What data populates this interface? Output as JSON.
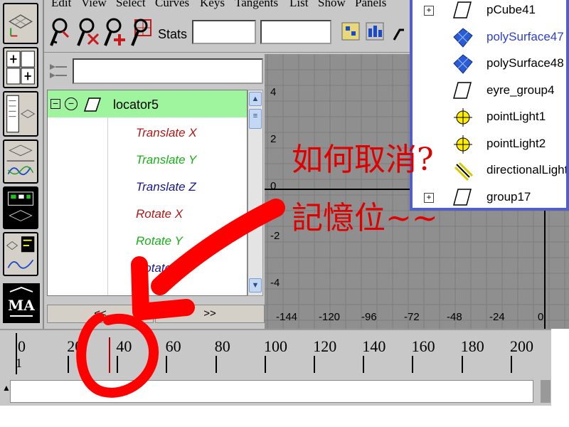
{
  "menubar": {
    "items": [
      "Edit",
      "View",
      "Select",
      "Curves",
      "Keys",
      "Tangents",
      "List",
      "Show",
      "Panels"
    ]
  },
  "toolbar": {
    "stats_label": "Stats",
    "stats_value_1": "",
    "stats_value_2": ""
  },
  "outliner": {
    "filter_value": "",
    "selected_node": "locator5",
    "attributes": [
      {
        "label": "Translate X",
        "color": "#b01818"
      },
      {
        "label": "Translate Y",
        "color": "#18b018"
      },
      {
        "label": "Translate Z",
        "color": "#18188a"
      },
      {
        "label": "Rotate X",
        "color": "#b01818"
      },
      {
        "label": "Rotate Y",
        "color": "#18b018"
      },
      {
        "label": "Rotate Z",
        "color": "#18188a"
      }
    ],
    "scroll_left": "<<",
    "scroll_right": ">>"
  },
  "graph": {
    "y_ticks": [
      "4",
      "2",
      "0",
      "-2",
      "-4"
    ],
    "x_ticks": [
      "-144",
      "-120",
      "-96",
      "-72",
      "-48",
      "-24",
      "0"
    ]
  },
  "outliner_panel": {
    "items": [
      {
        "name": "pCube41",
        "icon": "transform-icon",
        "expandable": true,
        "blue": false
      },
      {
        "name": "polySurface47",
        "icon": "poly-surface-icon",
        "expandable": false,
        "blue": true
      },
      {
        "name": "polySurface48",
        "icon": "poly-surface-icon",
        "expandable": false,
        "blue": false
      },
      {
        "name": "eyre_group4",
        "icon": "transform-icon",
        "expandable": false,
        "blue": false
      },
      {
        "name": "pointLight1",
        "icon": "point-light-icon",
        "expandable": false,
        "blue": false
      },
      {
        "name": "pointLight2",
        "icon": "point-light-icon",
        "expandable": false,
        "blue": false
      },
      {
        "name": "directionalLight",
        "icon": "directional-light-icon",
        "expandable": false,
        "blue": false
      },
      {
        "name": "group17",
        "icon": "transform-icon",
        "expandable": true,
        "blue": false
      }
    ]
  },
  "timeline": {
    "labels": [
      "0",
      "20",
      "40",
      "60",
      "80",
      "100",
      "120",
      "140",
      "160",
      "180",
      "200"
    ],
    "current_frame": "1"
  },
  "command_line": {
    "value": ""
  },
  "annotation": {
    "line1": "如何取消?",
    "line2": "記憶位~~",
    "color": "#e00000"
  }
}
